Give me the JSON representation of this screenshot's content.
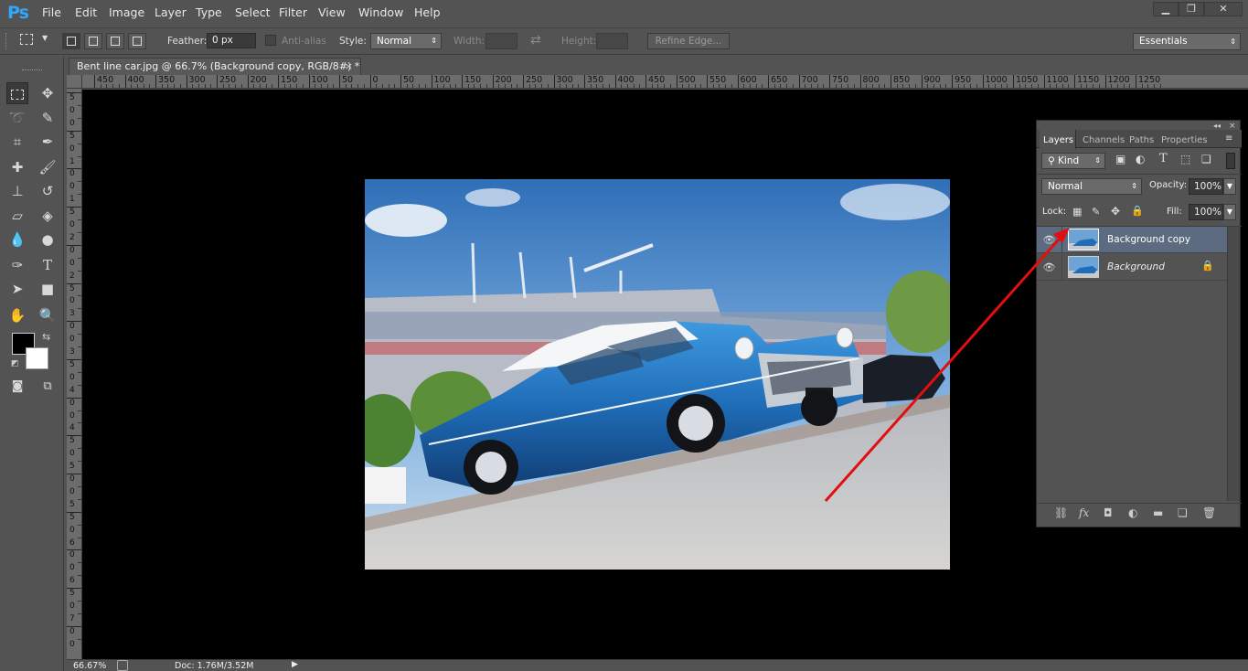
{
  "app": {
    "logo": "Ps",
    "menu": [
      "File",
      "Edit",
      "Image",
      "Layer",
      "Type",
      "Select",
      "Filter",
      "View",
      "Window",
      "Help"
    ],
    "window_controls": [
      "minimize",
      "restore",
      "close"
    ]
  },
  "options": {
    "feather_label": "Feather:",
    "feather_value": "0 px",
    "antialias_label": "Anti-alias",
    "style_label": "Style:",
    "style_value": "Normal",
    "width_label": "Width:",
    "height_label": "Height:",
    "refine_edge": "Refine Edge...",
    "workspace": "Essentials"
  },
  "document": {
    "tab_title": "Bent line car.jpg @ 66.7% (Background copy, RGB/8#) *",
    "close_glyph": "×"
  },
  "ruler": {
    "top_labels": [
      "450",
      "400",
      "350",
      "300",
      "250",
      "200",
      "150",
      "100",
      "50",
      "0",
      "50",
      "100",
      "150",
      "200",
      "250",
      "300",
      "350",
      "400",
      "450",
      "500",
      "550",
      "600",
      "650",
      "700",
      "750",
      "800",
      "850",
      "900",
      "950",
      "1000",
      "1050",
      "1100",
      "1150",
      "1200",
      "1250"
    ],
    "left_labels": [
      "5",
      "0",
      "0",
      "5",
      "0",
      "1",
      "0",
      "0",
      "1",
      "5",
      "0",
      "2",
      "0",
      "0",
      "2",
      "5",
      "0",
      "3",
      "0",
      "0",
      "3",
      "5",
      "0",
      "4",
      "0",
      "0",
      "4",
      "5",
      "0",
      "5",
      "0",
      "0",
      "5",
      "5",
      "0",
      "6",
      "0",
      "0",
      "6",
      "5",
      "0",
      "7",
      "0",
      "0"
    ]
  },
  "status": {
    "zoom": "66.67%",
    "doc": "Doc: 1.76M/3.52M"
  },
  "layers_panel": {
    "tabs": [
      "Layers",
      "Channels",
      "Paths",
      "Properties"
    ],
    "filter_kind": "Kind",
    "blend_mode": "Normal",
    "opacity_label": "Opacity:",
    "opacity_value": "100%",
    "lock_label": "Lock:",
    "fill_label": "Fill:",
    "fill_value": "100%",
    "layers": [
      {
        "name": "Background copy",
        "selected": true,
        "visible": true,
        "locked": false
      },
      {
        "name": "Background",
        "selected": false,
        "visible": true,
        "locked": true
      }
    ],
    "footer_icons": [
      "link-icon",
      "fx-icon",
      "mask-icon",
      "adjustment-icon",
      "group-icon",
      "new-layer-icon",
      "trash-icon"
    ]
  },
  "colors": {
    "ui_bg": "#535353",
    "canvas_bg": "#000000",
    "selected_layer": "#5d6b80",
    "annotation_arrow": "#e01010",
    "ps_blue": "#31a8ff"
  }
}
